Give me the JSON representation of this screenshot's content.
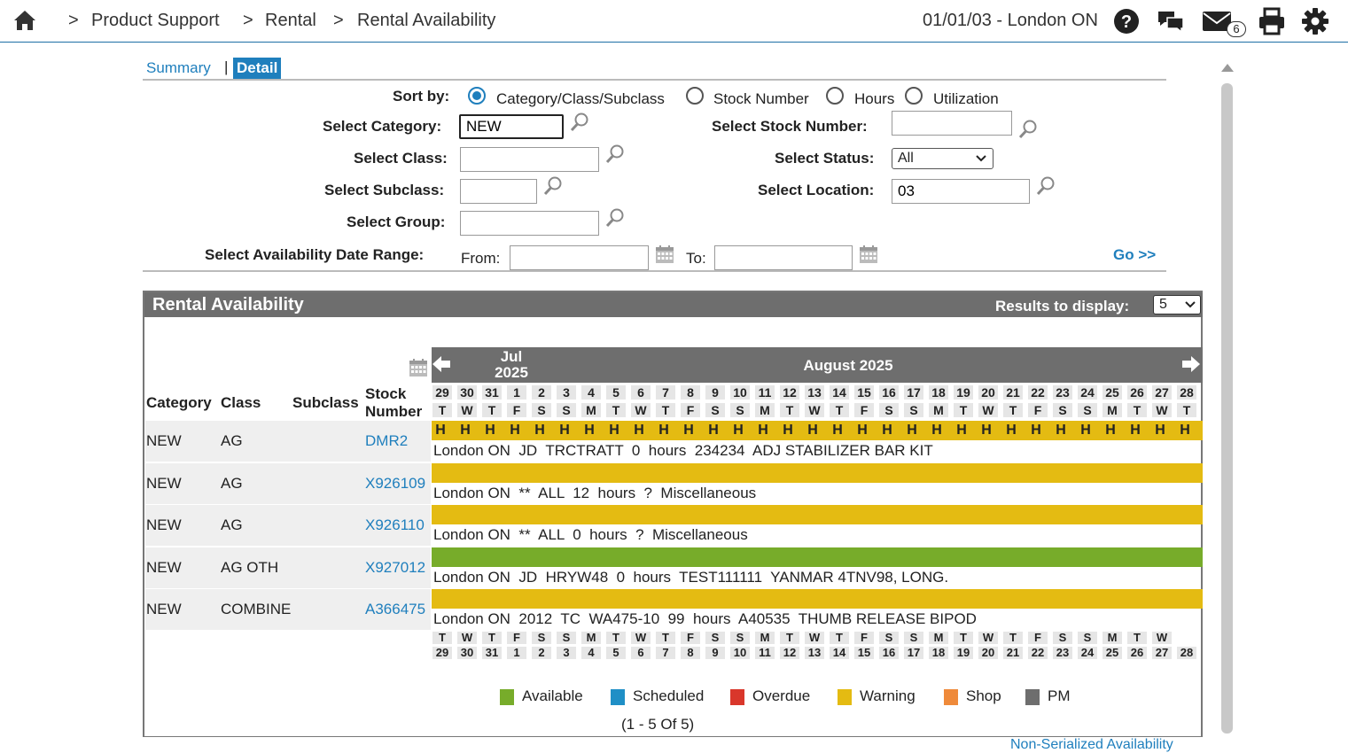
{
  "header": {
    "breadcrumbs": [
      {
        "sep": ">",
        "label": "Product Support"
      },
      {
        "sep": ">",
        "label": "Rental"
      },
      {
        "sep": ">",
        "label": "Rental Availability"
      }
    ],
    "date_location": "01/01/03 - London ON",
    "mail_count": "6",
    "icons": [
      "home-icon",
      "help-icon",
      "chat-icon",
      "mail-icon",
      "print-icon",
      "gear-icon"
    ]
  },
  "tabs": {
    "summary": "Summary",
    "separator": "|",
    "detail": "Detail",
    "active": "Detail"
  },
  "filters": {
    "sort_by_label": "Sort by:",
    "sort_options": [
      "Category/Class/Subclass",
      "Stock Number",
      "Hours",
      "Utilization"
    ],
    "sort_selected": 0,
    "category_label": "Select Category:",
    "category_value": "NEW",
    "class_label": "Select Class:",
    "class_value": "",
    "subclass_label": "Select Subclass:",
    "subclass_value": "",
    "group_label": "Select Group:",
    "group_value": "",
    "stock_number_label": "Select Stock Number:",
    "stock_number_value": "",
    "status_label": "Select Status:",
    "status_value": "All",
    "location_label": "Select Location:",
    "location_value": "03",
    "date_range_label": "Select Availability Date Range:",
    "from_label": "From:",
    "from_value": "",
    "to_label": "To:",
    "to_value": "",
    "go_label": "Go >>"
  },
  "availability": {
    "title": "Rental Availability",
    "results_label": "Results to display:",
    "results_value": "5",
    "columns": {
      "category": "Category",
      "class": "Class",
      "subclass": "Subclass",
      "stock_1": "Stock",
      "stock_2": "Number"
    },
    "month_prev": {
      "line1": "Jul",
      "line2": "2025"
    },
    "month_current": "August 2025",
    "days": [
      "29",
      "30",
      "31",
      "1",
      "2",
      "3",
      "4",
      "5",
      "6",
      "7",
      "8",
      "9",
      "10",
      "11",
      "12",
      "13",
      "14",
      "15",
      "16",
      "17",
      "18",
      "19",
      "20",
      "21",
      "22",
      "23",
      "24",
      "25",
      "26",
      "27",
      "28"
    ],
    "weekdays": [
      "T",
      "W",
      "T",
      "F",
      "S",
      "S",
      "M",
      "T",
      "W",
      "T",
      "F",
      "S",
      "S",
      "M",
      "T",
      "W",
      "T",
      "F",
      "S",
      "S",
      "M",
      "T",
      "W",
      "T",
      "F",
      "S",
      "S",
      "M",
      "T",
      "W",
      "T"
    ],
    "rows": [
      {
        "category": "NEW",
        "class": "AG",
        "subclass": "",
        "stock": "DMR2",
        "status": "hold",
        "hold_mark": "H",
        "detail": "London ON  JD  TRCTRATT  0  hours  234234  ADJ STABILIZER BAR KIT"
      },
      {
        "category": "NEW",
        "class": "AG",
        "subclass": "",
        "stock": "X926109",
        "status": "warning",
        "detail": "London ON  **  ALL  12  hours  ?  Miscellaneous"
      },
      {
        "category": "NEW",
        "class": "AG",
        "subclass": "",
        "stock": "X926110",
        "status": "warning",
        "detail": "London ON  **  ALL  0  hours  ?  Miscellaneous"
      },
      {
        "category": "NEW",
        "class": "AG OTH",
        "subclass": "",
        "stock": "X927012",
        "status": "available",
        "detail": "London ON  JD  HRYW48  0  hours  TEST111111  YANMAR 4TNV98, LONG."
      },
      {
        "category": "NEW",
        "class": "COMBINE",
        "subclass": "",
        "stock": "A366475",
        "status": "warning",
        "detail": "London ON  2012  TC  WA475-10  99  hours  A40535  THUMB RELEASE BIPOD"
      }
    ],
    "legend": [
      {
        "label": "Available",
        "color": "#77ac2a"
      },
      {
        "label": "Scheduled",
        "color": "#1f8fc6"
      },
      {
        "label": "Overdue",
        "color": "#d9372b"
      },
      {
        "label": "Warning",
        "color": "#e4bb12"
      },
      {
        "label": "Shop",
        "color": "#ef8a3a"
      },
      {
        "label": "PM",
        "color": "#6e6e6e"
      }
    ],
    "pager": "(1  -  5  Of  5)",
    "footer_link": "Non-Serialized Availability"
  },
  "colors": {
    "accent": "#1f7fbd",
    "hold": "#e4bb12",
    "warning": "#e4bb12",
    "available": "#77ac2a",
    "header_gray": "#6e6e6e"
  }
}
